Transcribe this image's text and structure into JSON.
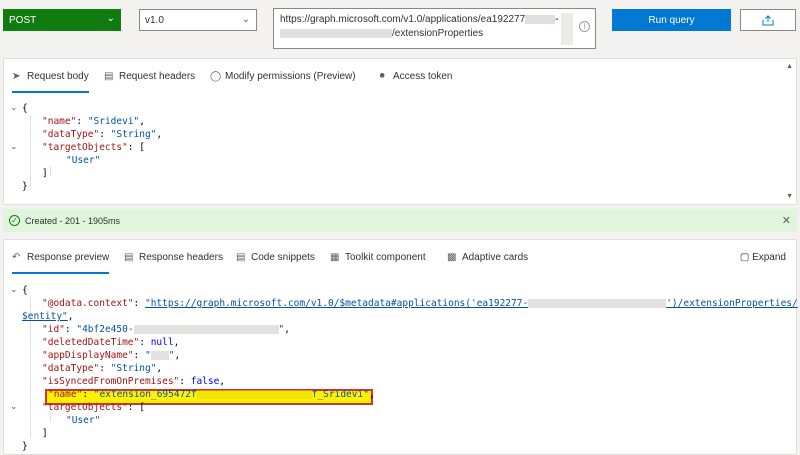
{
  "toolbar": {
    "method": "POST",
    "version": "v1.0",
    "url_line1": "https://graph.microsoft.com/v1.0/applications/ea192277",
    "url_line2_suffix": "/extensionProperties",
    "run_label": "Run query"
  },
  "request_tabs": [
    {
      "label": "Request body"
    },
    {
      "label": "Request headers"
    },
    {
      "label": "Modify permissions (Preview)"
    },
    {
      "label": "Access token"
    }
  ],
  "request_body": {
    "open": "{",
    "name_key": "\"name\"",
    "name_val": "\"Sridevi\"",
    "type_key": "\"dataType\"",
    "type_val": "\"String\"",
    "targets_key": "\"targetObjects\"",
    "targets_open": "[",
    "target_val": "\"User\"",
    "targets_close": "]",
    "close": "}"
  },
  "status": {
    "text": "Created - 201 - 1905ms"
  },
  "response_tabs": [
    {
      "label": "Response preview"
    },
    {
      "label": "Response headers"
    },
    {
      "label": "Code snippets"
    },
    {
      "label": "Toolkit component"
    },
    {
      "label": "Adaptive cards"
    }
  ],
  "expand_label": "Expand",
  "response_body": {
    "open": "{",
    "context_key": "\"@odata.context\"",
    "context_val_a": "\"https://graph.microsoft.com/v1.0/$metadata#applications('ea192277-",
    "context_val_b": "')/extensionProperties/",
    "context_val_c": "$entity\"",
    "id_key": "\"id\"",
    "id_val": "\"4bf2e450-",
    "deleted_key": "\"deletedDateTime\"",
    "deleted_val": "null",
    "app_key": "\"appDisplayName\"",
    "type_key": "\"dataType\"",
    "type_val": "\"String\"",
    "synced_key": "\"isSyncedFromOnPremises\"",
    "synced_val": "false",
    "name_key": "\"name\"",
    "name_val_a": "\"extension_695472f",
    "name_val_b": "f_Sridevi\"",
    "targets_key": "\"targetObjects\"",
    "targets_open": "[",
    "target_val": "\"User\"",
    "targets_close": "]",
    "close": "}"
  }
}
